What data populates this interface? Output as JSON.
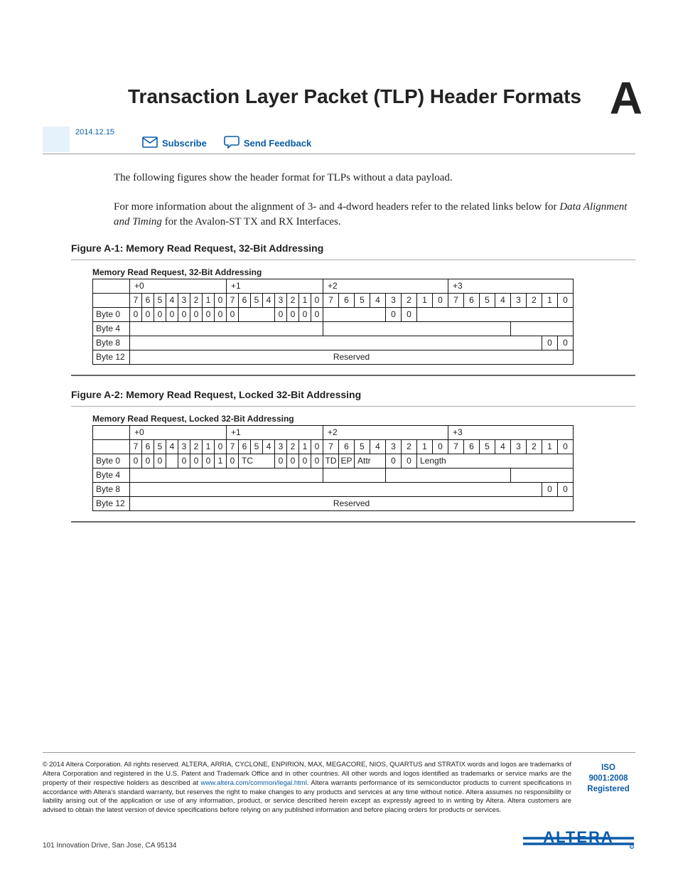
{
  "header": {
    "title": "Transaction Layer Packet (TLP) Header Formats",
    "appendix_letter": "A",
    "date": "2014.12.15"
  },
  "links": {
    "subscribe": "Subscribe",
    "send_feedback": "Send Feedback"
  },
  "paragraphs": {
    "p1": "The following figures show the header format for TLPs without a data payload.",
    "p2a": "For more information about the alignment of 3- and 4-dword headers refer to the related links below for ",
    "p2b_italic": "Data Alignment and Timing",
    "p2c": " for the Avalon-ST TX and RX Interfaces."
  },
  "figure1": {
    "caption": "Figure A-1: Memory Read Request, 32-Bit Addressing",
    "subtitle": "Memory Read Request, 32-Bit Addressing",
    "group_headers": [
      "+0",
      "+1",
      "+2",
      "+3"
    ],
    "bit_labels": [
      "7",
      "6",
      "5",
      "4",
      "3",
      "2",
      "1",
      "0",
      "7",
      "6",
      "5",
      "4",
      "3",
      "2",
      "1",
      "0",
      "7",
      "6",
      "5",
      "4",
      "3",
      "2",
      "1",
      "0",
      "7",
      "6",
      "5",
      "4",
      "3",
      "2",
      "1",
      "0"
    ],
    "byte0": {
      "left8": [
        "0",
        "0",
        "0",
        "0",
        "0",
        "0",
        "0",
        "0"
      ],
      "b8": "0",
      "b12_15": [
        "0",
        "0",
        "0",
        "0"
      ],
      "b20_21": [
        "0",
        "0"
      ],
      "last2": [
        "0",
        "0"
      ]
    },
    "rows": [
      "Byte 0",
      "Byte 4",
      "Byte 8",
      "Byte 12"
    ],
    "reserved": "Reserved"
  },
  "figure2": {
    "caption": "Figure A-2: Memory Read Request, Locked 32-Bit Addressing",
    "subtitle": "Memory Read Request, Locked 32-Bit Addressing",
    "group_headers": [
      "+0",
      "+1",
      "+2",
      "+3"
    ],
    "bit_labels": [
      "7",
      "6",
      "5",
      "4",
      "3",
      "2",
      "1",
      "0",
      "7",
      "6",
      "5",
      "4",
      "3",
      "2",
      "1",
      "0",
      "7",
      "6",
      "5",
      "4",
      "3",
      "2",
      "1",
      "0",
      "7",
      "6",
      "5",
      "4",
      "3",
      "2",
      "1",
      "0"
    ],
    "byte0": {
      "left3": [
        "0",
        "0",
        "0"
      ],
      "mid4": [
        "0",
        "0",
        "0",
        "1"
      ],
      "b8": "0",
      "tc": "TC",
      "b12_15": [
        "0",
        "0",
        "0",
        "0"
      ],
      "td": "TD",
      "ep": "EP",
      "attr": "Attr",
      "b20_21": [
        "0",
        "0"
      ],
      "length": "Length"
    },
    "rows": [
      "Byte 0",
      "Byte 4",
      "Byte 8",
      "Byte 12"
    ],
    "reserved": "Reserved",
    "last2": [
      "0",
      "0"
    ]
  },
  "footer": {
    "copyright_prefix": "©",
    "legal_a": " 2014 Altera Corporation. All rights reserved. ALTERA, ARRIA, CYCLONE, ENPIRION, MAX, MEGACORE, NIOS, QUARTUS and STRATIX words and logos are trademarks of Altera Corporation and registered in the U.S. Patent and Trademark Office and in other countries. All other words and logos identified as trademarks or service marks are the property of their respective holders as described at ",
    "legal_link": "www.altera.com/common/legal.html",
    "legal_b": ". Altera warrants performance of its semiconductor products to current specifications in accordance with Altera's standard warranty, but reserves the right to make changes to any products and services at any time without notice. Altera assumes no responsibility or liability arising out of the application or use of any information, product, or service described herein except as expressly agreed to in writing by Altera. Altera customers are advised to obtain the latest version of device specifications before relying on any published information and before placing orders for products or services.",
    "iso_line1": "ISO",
    "iso_line2": "9001:2008",
    "iso_line3": "Registered",
    "address": "101 Innovation Drive, San Jose, CA 95134",
    "logo_text": "ALTERA"
  }
}
